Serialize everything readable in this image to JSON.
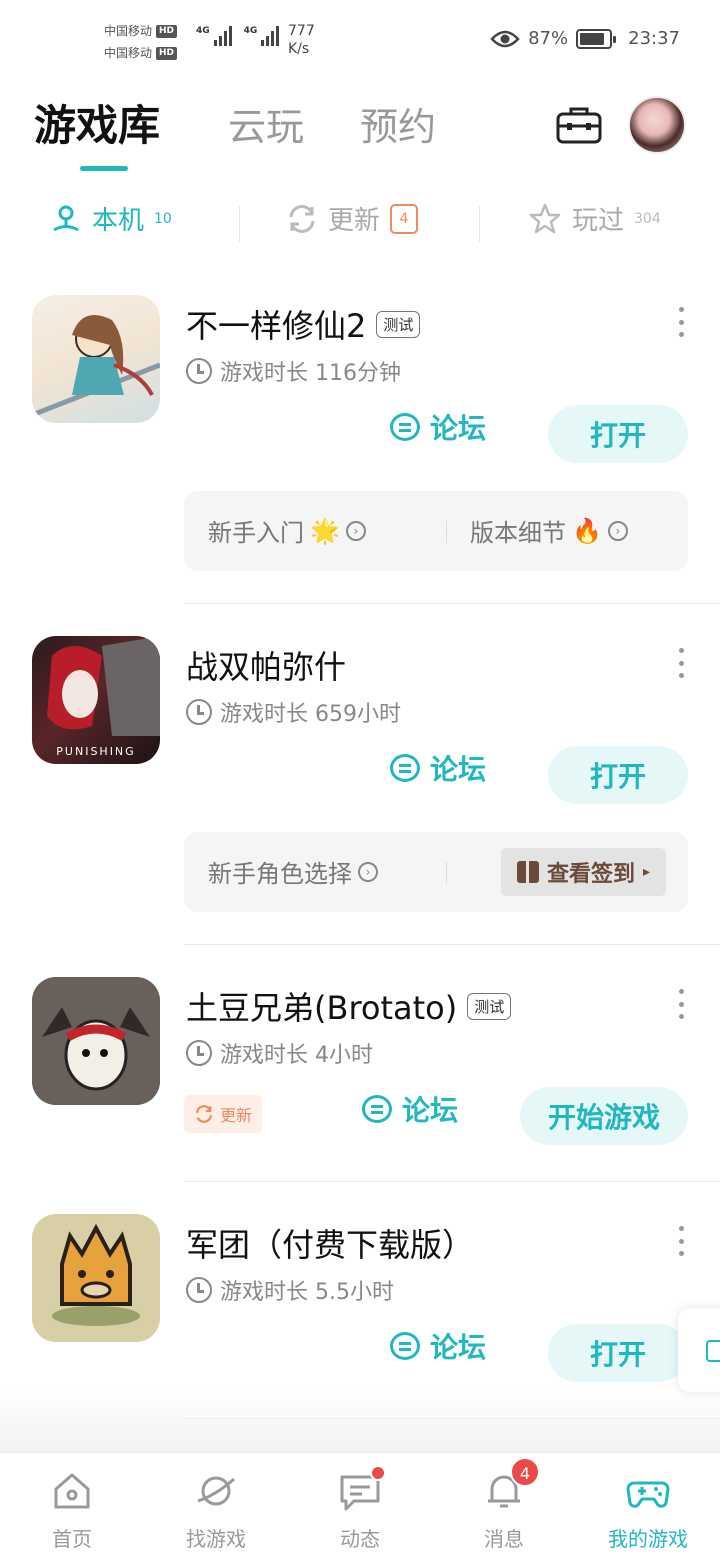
{
  "status_bar": {
    "carrier_1": "中国移动",
    "carrier_2": "中国移动",
    "hd_label": "HD",
    "network_label": "4G",
    "net_speed_value": "777",
    "net_speed_unit": "K/s",
    "battery_percent": "87%",
    "battery_level": 0.87,
    "time": "23:37"
  },
  "header": {
    "tabs": [
      {
        "label": "游戏库"
      },
      {
        "label": "云玩"
      },
      {
        "label": "预约"
      }
    ],
    "toolbox_icon": "toolbox-icon",
    "avatar_icon": "avatar"
  },
  "subtabs": [
    {
      "label": "本机",
      "count": "10",
      "icon": "person-pin-icon"
    },
    {
      "label": "更新",
      "badge": "4",
      "icon": "refresh-icon"
    },
    {
      "label": "玩过",
      "count": "304",
      "icon": "star-icon"
    }
  ],
  "games": [
    {
      "title": "不一样修仙2",
      "tag": "测试",
      "playtime": "游戏时长 116分钟",
      "forum_label": "论坛",
      "action_label": "打开",
      "panel": [
        {
          "label": "新手入门",
          "emoji": "🌟"
        },
        {
          "label": "版本细节",
          "emoji": "🔥"
        }
      ]
    },
    {
      "title": "战双帕弥什",
      "tag": "",
      "playtime": "游戏时长 659小时",
      "forum_label": "论坛",
      "action_label": "打开",
      "icon_text": "PUNISHING",
      "panel": [
        {
          "label": "新手角色选择"
        }
      ],
      "signin_label": "查看签到"
    },
    {
      "title": "土豆兄弟(Brotato)",
      "tag": "测试",
      "playtime": "游戏时长 4小时",
      "update_label": "更新",
      "forum_label": "论坛",
      "action_label": "开始游戏"
    },
    {
      "title": "军团（付费下载版）",
      "tag": "",
      "playtime": "游戏时长 5.5小时",
      "forum_label": "论坛",
      "action_label": "打开"
    }
  ],
  "bottom_nav": [
    {
      "label": "首页",
      "icon": "home-icon"
    },
    {
      "label": "找游戏",
      "icon": "planet-icon"
    },
    {
      "label": "动态",
      "icon": "chat-icon",
      "dot": true
    },
    {
      "label": "消息",
      "icon": "bell-icon",
      "badge": "4"
    },
    {
      "label": "我的游戏",
      "icon": "gamepad-icon",
      "active": true
    }
  ],
  "colors": {
    "accent": "#1fb8c1",
    "update": "#f08a5d",
    "badge": "#e94a4a"
  }
}
